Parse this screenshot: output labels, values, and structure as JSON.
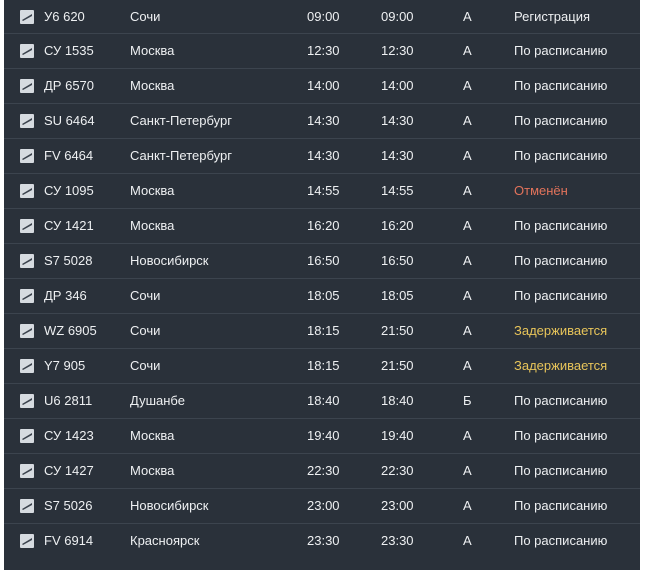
{
  "colors": {
    "background": "#2a313a",
    "text": "#eef0f2",
    "cancelled": "#e2735b",
    "delayed": "#e8c55a"
  },
  "flights": [
    {
      "icon": "airline-logo-icon",
      "flight": "У6 620",
      "city": "Сочи",
      "scheduled": "09:00",
      "actual": "09:00",
      "terminal": "A",
      "status": "Регистрация",
      "status_type": "checkin"
    },
    {
      "icon": "airline-logo-icon",
      "flight": "СУ 1535",
      "city": "Москва",
      "scheduled": "12:30",
      "actual": "12:30",
      "terminal": "A",
      "status": "По расписанию",
      "status_type": "normal"
    },
    {
      "icon": "airline-logo-icon",
      "flight": "ДР 6570",
      "city": "Москва",
      "scheduled": "14:00",
      "actual": "14:00",
      "terminal": "A",
      "status": "По расписанию",
      "status_type": "normal"
    },
    {
      "icon": "airline-logo-icon",
      "flight": "SU 6464",
      "city": "Санкт-Петербург",
      "scheduled": "14:30",
      "actual": "14:30",
      "terminal": "A",
      "status": "По расписанию",
      "status_type": "normal"
    },
    {
      "icon": "airline-logo-icon",
      "flight": "FV 6464",
      "city": "Санкт-Петербург",
      "scheduled": "14:30",
      "actual": "14:30",
      "terminal": "A",
      "status": "По расписанию",
      "status_type": "normal"
    },
    {
      "icon": "airline-logo-icon",
      "flight": "СУ 1095",
      "city": "Москва",
      "scheduled": "14:55",
      "actual": "14:55",
      "terminal": "A",
      "status": "Отменён",
      "status_type": "cancelled"
    },
    {
      "icon": "airline-logo-icon",
      "flight": "СУ 1421",
      "city": "Москва",
      "scheduled": "16:20",
      "actual": "16:20",
      "terminal": "A",
      "status": "По расписанию",
      "status_type": "normal"
    },
    {
      "icon": "airline-logo-icon",
      "flight": "S7 5028",
      "city": "Новосибирск",
      "scheduled": "16:50",
      "actual": "16:50",
      "terminal": "A",
      "status": "По расписанию",
      "status_type": "normal"
    },
    {
      "icon": "airline-logo-icon",
      "flight": "ДР 346",
      "city": "Сочи",
      "scheduled": "18:05",
      "actual": "18:05",
      "terminal": "A",
      "status": "По расписанию",
      "status_type": "normal"
    },
    {
      "icon": "airline-logo-icon",
      "flight": "WZ 6905",
      "city": "Сочи",
      "scheduled": "18:15",
      "actual": "21:50",
      "terminal": "A",
      "status": "Задерживается",
      "status_type": "delayed"
    },
    {
      "icon": "airline-logo-icon",
      "flight": "Y7 905",
      "city": "Сочи",
      "scheduled": "18:15",
      "actual": "21:50",
      "terminal": "A",
      "status": "Задерживается",
      "status_type": "delayed"
    },
    {
      "icon": "airline-logo-icon",
      "flight": "U6 2811",
      "city": "Душанбе",
      "scheduled": "18:40",
      "actual": "18:40",
      "terminal": "Б",
      "status": "По расписанию",
      "status_type": "normal"
    },
    {
      "icon": "airline-logo-icon",
      "flight": "СУ 1423",
      "city": "Москва",
      "scheduled": "19:40",
      "actual": "19:40",
      "terminal": "A",
      "status": "По расписанию",
      "status_type": "normal"
    },
    {
      "icon": "airline-logo-icon",
      "flight": "СУ 1427",
      "city": "Москва",
      "scheduled": "22:30",
      "actual": "22:30",
      "terminal": "A",
      "status": "По расписанию",
      "status_type": "normal"
    },
    {
      "icon": "airline-logo-icon",
      "flight": "S7 5026",
      "city": "Новосибирск",
      "scheduled": "23:00",
      "actual": "23:00",
      "terminal": "A",
      "status": "По расписанию",
      "status_type": "normal"
    },
    {
      "icon": "airline-logo-icon",
      "flight": "FV 6914",
      "city": "Красноярск",
      "scheduled": "23:30",
      "actual": "23:30",
      "terminal": "A",
      "status": "По расписанию",
      "status_type": "normal"
    }
  ]
}
